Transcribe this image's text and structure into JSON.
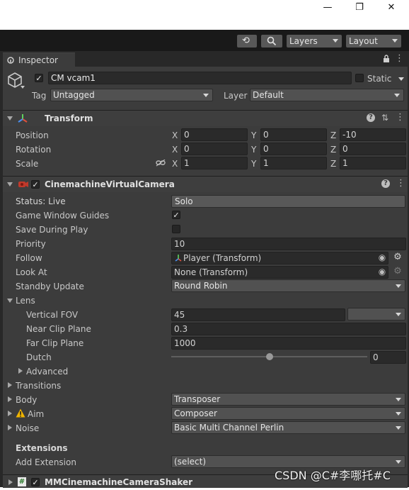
{
  "window": {
    "minimize_glyph": "—",
    "maximize_glyph": "❐",
    "close_glyph": "✕"
  },
  "toolbar": {
    "history_icon": "history-icon",
    "search_icon": "search-icon",
    "layers_label": "Layers",
    "layout_label": "Layout"
  },
  "inspector": {
    "tab_label": "Inspector",
    "object_name": "CM vcam1",
    "active": true,
    "static_label": "Static",
    "tag_label": "Tag",
    "tag_value": "Untagged",
    "layer_label": "Layer",
    "layer_value": "Default"
  },
  "transform": {
    "title": "Transform",
    "rows": [
      {
        "label": "Position",
        "x": "0",
        "y": "0",
        "z": "-10"
      },
      {
        "label": "Rotation",
        "x": "0",
        "y": "0",
        "z": "0"
      },
      {
        "label": "Scale",
        "x": "1",
        "y": "1",
        "z": "1"
      }
    ],
    "axis_x": "X",
    "axis_y": "Y",
    "axis_z": "Z"
  },
  "vcam": {
    "title": "CinemachineVirtualCamera",
    "status_label": "Status: Live",
    "solo_label": "Solo",
    "game_window_guides_label": "Game Window Guides",
    "game_window_guides": true,
    "save_during_play_label": "Save During Play",
    "save_during_play": false,
    "priority_label": "Priority",
    "priority_value": "10",
    "follow_label": "Follow",
    "follow_value": "Player (Transform)",
    "look_at_label": "Look At",
    "look_at_value": "None (Transform)",
    "standby_label": "Standby Update",
    "standby_value": "Round Robin",
    "lens_label": "Lens",
    "fov_label": "Vertical FOV",
    "fov_value": "45",
    "fov_preset_value": "",
    "near_label": "Near Clip Plane",
    "near_value": "0.3",
    "far_label": "Far Clip Plane",
    "far_value": "1000",
    "dutch_label": "Dutch",
    "dutch_value": "0",
    "dutch_slider_fraction": 0.5,
    "advanced_label": "Advanced",
    "transitions_label": "Transitions",
    "body_label": "Body",
    "body_value": "Transposer",
    "aim_label": "Aim",
    "aim_value": "Composer",
    "noise_label": "Noise",
    "noise_value": "Basic Multi Channel Perlin",
    "extensions_label": "Extensions",
    "add_extension_label": "Add Extension",
    "add_extension_value": "(select)"
  },
  "shaker": {
    "title": "MMCinemachineCameraShaker"
  },
  "watermark": "CSDN @C#李哪托#C",
  "colors": {
    "panel": "#3c3c3c",
    "field": "#2a2a2a",
    "dropdown": "#515151",
    "warning": "#f0b400",
    "follow_icon_green": "#3fbf3f"
  }
}
